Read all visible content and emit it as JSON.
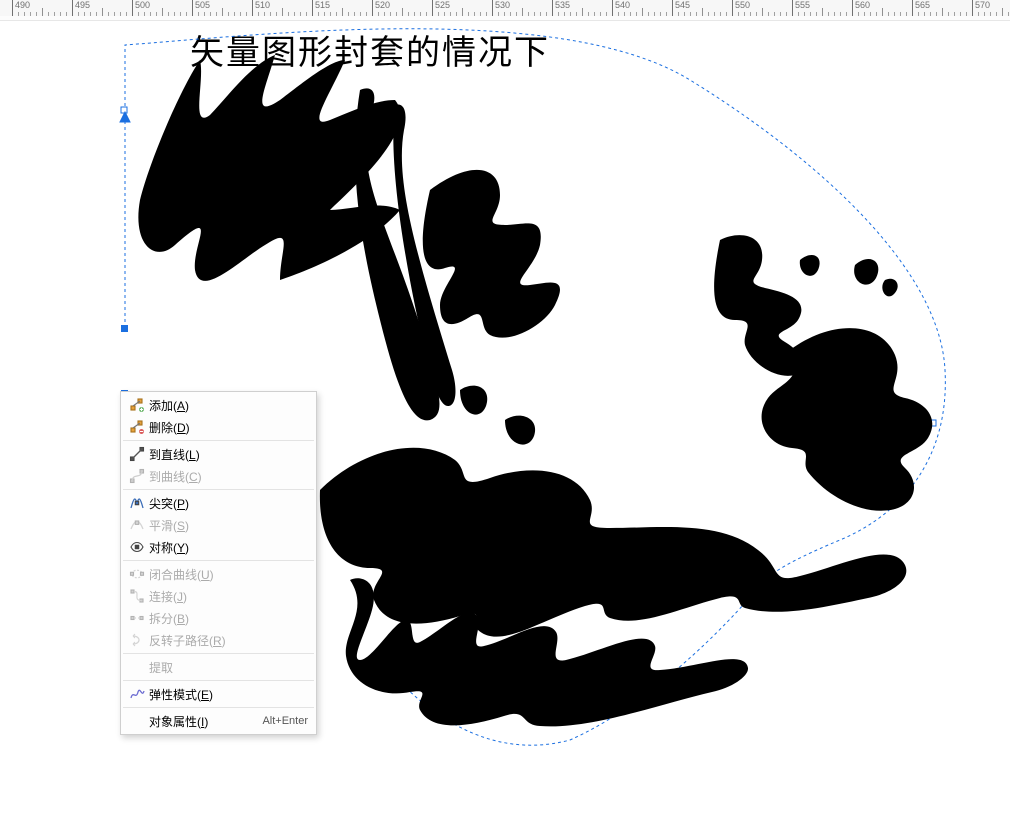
{
  "ruler": {
    "labels": [
      "490",
      "495",
      "500",
      "505",
      "510",
      "515",
      "520",
      "525",
      "530",
      "535",
      "540",
      "545",
      "550",
      "555",
      "560",
      "565",
      "570"
    ]
  },
  "canvas": {
    "title_text": "矢量图形封套的情况下"
  },
  "context_menu": {
    "items": [
      {
        "label_pre": "添加(",
        "hotkey": "A",
        "label_post": ")",
        "enabled": true,
        "icon": "add-node-icon"
      },
      {
        "label_pre": "删除(",
        "hotkey": "D",
        "label_post": ")",
        "enabled": true,
        "icon": "delete-node-icon"
      },
      {
        "sep": true
      },
      {
        "label_pre": "到直线(",
        "hotkey": "L",
        "label_post": ")",
        "enabled": true,
        "icon": "to-line-icon"
      },
      {
        "label_pre": "到曲线(",
        "hotkey": "C",
        "label_post": ")",
        "enabled": false,
        "icon": "to-curve-icon"
      },
      {
        "sep": true
      },
      {
        "label_pre": "尖突(",
        "hotkey": "P",
        "label_post": ")",
        "enabled": true,
        "icon": "cusp-icon"
      },
      {
        "label_pre": "平滑(",
        "hotkey": "S",
        "label_post": ")",
        "enabled": false,
        "icon": "smooth-icon"
      },
      {
        "label_pre": "对称(",
        "hotkey": "Y",
        "label_post": ")",
        "enabled": true,
        "icon": "symmetrical-icon"
      },
      {
        "sep": true
      },
      {
        "label_pre": "闭合曲线(",
        "hotkey": "U",
        "label_post": ")",
        "enabled": false,
        "icon": "close-curve-icon"
      },
      {
        "label_pre": "连接(",
        "hotkey": "J",
        "label_post": ")",
        "enabled": false,
        "icon": "join-icon"
      },
      {
        "label_pre": "拆分(",
        "hotkey": "B",
        "label_post": ")",
        "enabled": false,
        "icon": "break-icon"
      },
      {
        "label_pre": "反转子路径(",
        "hotkey": "R",
        "label_post": ")",
        "enabled": false,
        "icon": "reverse-subpath-icon"
      },
      {
        "sep": true
      },
      {
        "label_pre": "提取",
        "hotkey": "",
        "label_post": "",
        "enabled": false,
        "icon": ""
      },
      {
        "sep": true
      },
      {
        "label_pre": "弹性模式(",
        "hotkey": "E",
        "label_post": ")",
        "enabled": true,
        "icon": "elastic-mode-icon"
      },
      {
        "sep": true
      },
      {
        "label_pre": "对象属性(",
        "hotkey": "I",
        "label_post": ")",
        "enabled": true,
        "icon": "",
        "shortcut": "Alt+Enter"
      }
    ]
  }
}
